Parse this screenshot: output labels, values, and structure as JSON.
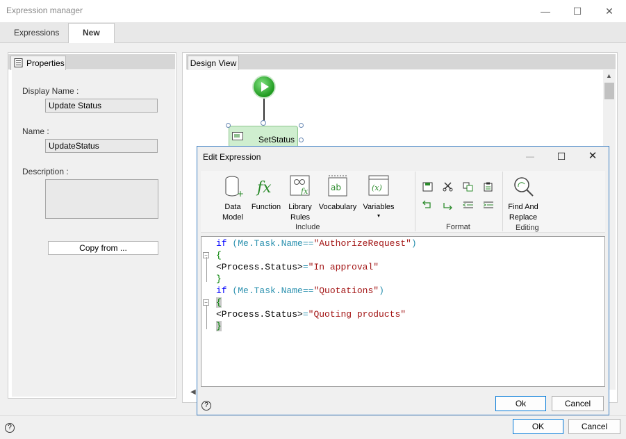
{
  "window": {
    "title": "Expression manager",
    "minimize": "—",
    "maximize": "☐",
    "close": "✕"
  },
  "tabs": [
    {
      "label": "Expressions"
    },
    {
      "label": "New"
    }
  ],
  "properties": {
    "tab_label": "Properties",
    "display_name_label": "Display Name :",
    "display_name_value": "Update Status",
    "name_label": "Name :",
    "name_value": "UpdateStatus",
    "description_label": "Description :",
    "description_value": "",
    "copy_button": "Copy from ..."
  },
  "design_view": {
    "tab_label": "Design View",
    "task_label": "SetStatus"
  },
  "edit_dialog": {
    "title": "Edit Expression",
    "ribbon": {
      "include_group": "Include",
      "format_group": "Format",
      "editing_group": "Editing",
      "buttons": [
        {
          "line1": "Data",
          "line2": "Model"
        },
        {
          "line1": "Function",
          "line2": ""
        },
        {
          "line1": "Library",
          "line2": "Rules"
        },
        {
          "line1": "Vocabulary",
          "line2": ""
        },
        {
          "line1": "Variables",
          "line2": "▾"
        }
      ],
      "find_replace": {
        "line1": "Find And",
        "line2": "Replace"
      }
    },
    "code_lines": [
      {
        "kw": "if",
        "a": " (",
        "id1": "Me.Task.Name",
        "op": "==",
        "str": "\"AuthorizeRequest\"",
        "z": ")"
      },
      {
        "text": "{"
      },
      {
        "pre": "<Process.Status>",
        "op": "=",
        "str": "\"In approval\""
      },
      {
        "text": "}"
      },
      {
        "kw": "if",
        "a": " (",
        "id1": "Me.Task.Name",
        "op": "==",
        "str": "\"Quotations\"",
        "z": ")"
      },
      {
        "text": "{"
      },
      {
        "pre": "<Process.Status>",
        "op": "=",
        "str": "\"Quoting products\""
      },
      {
        "text": "}"
      }
    ],
    "ok": "Ok",
    "cancel": "Cancel"
  },
  "footer": {
    "ok": "OK",
    "cancel": "Cancel"
  },
  "colors": {
    "accent": "#0078d7",
    "dialog_border": "#3c7fc4",
    "keyword": "#0000ff",
    "string": "#a31515"
  }
}
